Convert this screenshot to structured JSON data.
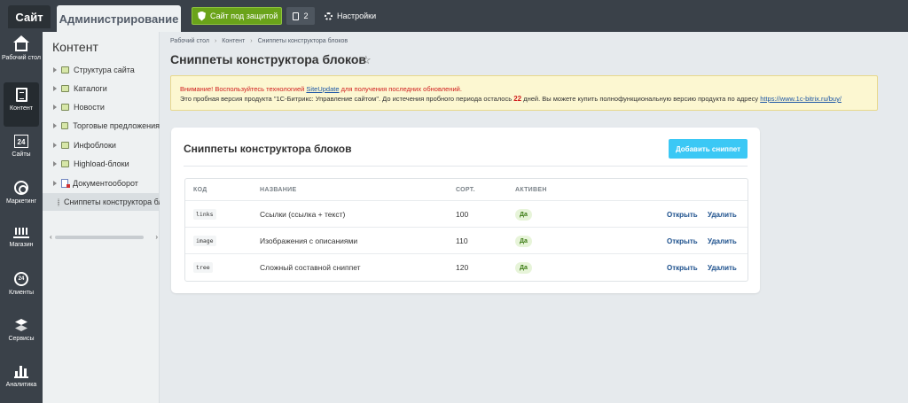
{
  "topbar": {
    "site_tab": "Сайт",
    "admin_tab": "Администрирование",
    "protect_label": "Сайт под защитой",
    "notif_count": "2",
    "settings_label": "Настройки"
  },
  "rail": [
    {
      "label": "Рабочий стол",
      "icon": "home-icon"
    },
    {
      "label": "Контент",
      "icon": "document-icon"
    },
    {
      "label": "Сайты",
      "icon": "calendar-icon",
      "glyph": "24"
    },
    {
      "label": "Маркетинг",
      "icon": "target-icon"
    },
    {
      "label": "Магазин",
      "icon": "basket-icon"
    },
    {
      "label": "Клиенты",
      "icon": "b24-icon",
      "glyph": "24"
    },
    {
      "label": "Сервисы",
      "icon": "layers-icon"
    },
    {
      "label": "Аналитика",
      "icon": "bar-chart-icon"
    }
  ],
  "tree": {
    "title": "Контент",
    "items": [
      {
        "label": "Структура сайта"
      },
      {
        "label": "Каталоги"
      },
      {
        "label": "Новости"
      },
      {
        "label": "Торговые предложения"
      },
      {
        "label": "Инфоблоки"
      },
      {
        "label": "Highload-блоки"
      },
      {
        "label": "Документооборот"
      },
      {
        "label": "Сниппеты конструктора блоков"
      }
    ]
  },
  "breadcrumb": [
    "Рабочий стол",
    "Контент",
    "Сниппеты конструктора блоков"
  ],
  "page_title": "Сниппеты конструктора блоков",
  "warning": {
    "line1_prefix": "Внимание! Воспользуйтесь технологией ",
    "link1": "SiteUpdate",
    "line1_suffix": " для получения последних обновлений.",
    "line2_prefix": "Это пробная версия продукта \"1С-Битрикс: Управление сайтом\". До истечения пробного периода осталось ",
    "days": "22",
    "line2_mid": " дней. Вы можете купить полнофункциональную версию продукта по адресу ",
    "link2": "https://www.1c-bitrix.ru/buy/"
  },
  "card": {
    "title": "Сниппеты конструктора блоков",
    "add_button": "Добавить сниппет",
    "columns": [
      "КОД",
      "НАЗВАНИЕ",
      "СОРТ.",
      "АКТИВЕН"
    ],
    "rows": [
      {
        "code": "links",
        "name": "Ссылки (ссылка + текст)",
        "sort": "100",
        "active": "Да",
        "open": "Открыть",
        "delete": "Удалить"
      },
      {
        "code": "image",
        "name": "Изображения с описаниями",
        "sort": "110",
        "active": "Да",
        "open": "Открыть",
        "delete": "Удалить"
      },
      {
        "code": "tree",
        "name": "Сложный составной сниппет",
        "sort": "120",
        "active": "Да",
        "open": "Открыть",
        "delete": "Удалить"
      }
    ]
  }
}
